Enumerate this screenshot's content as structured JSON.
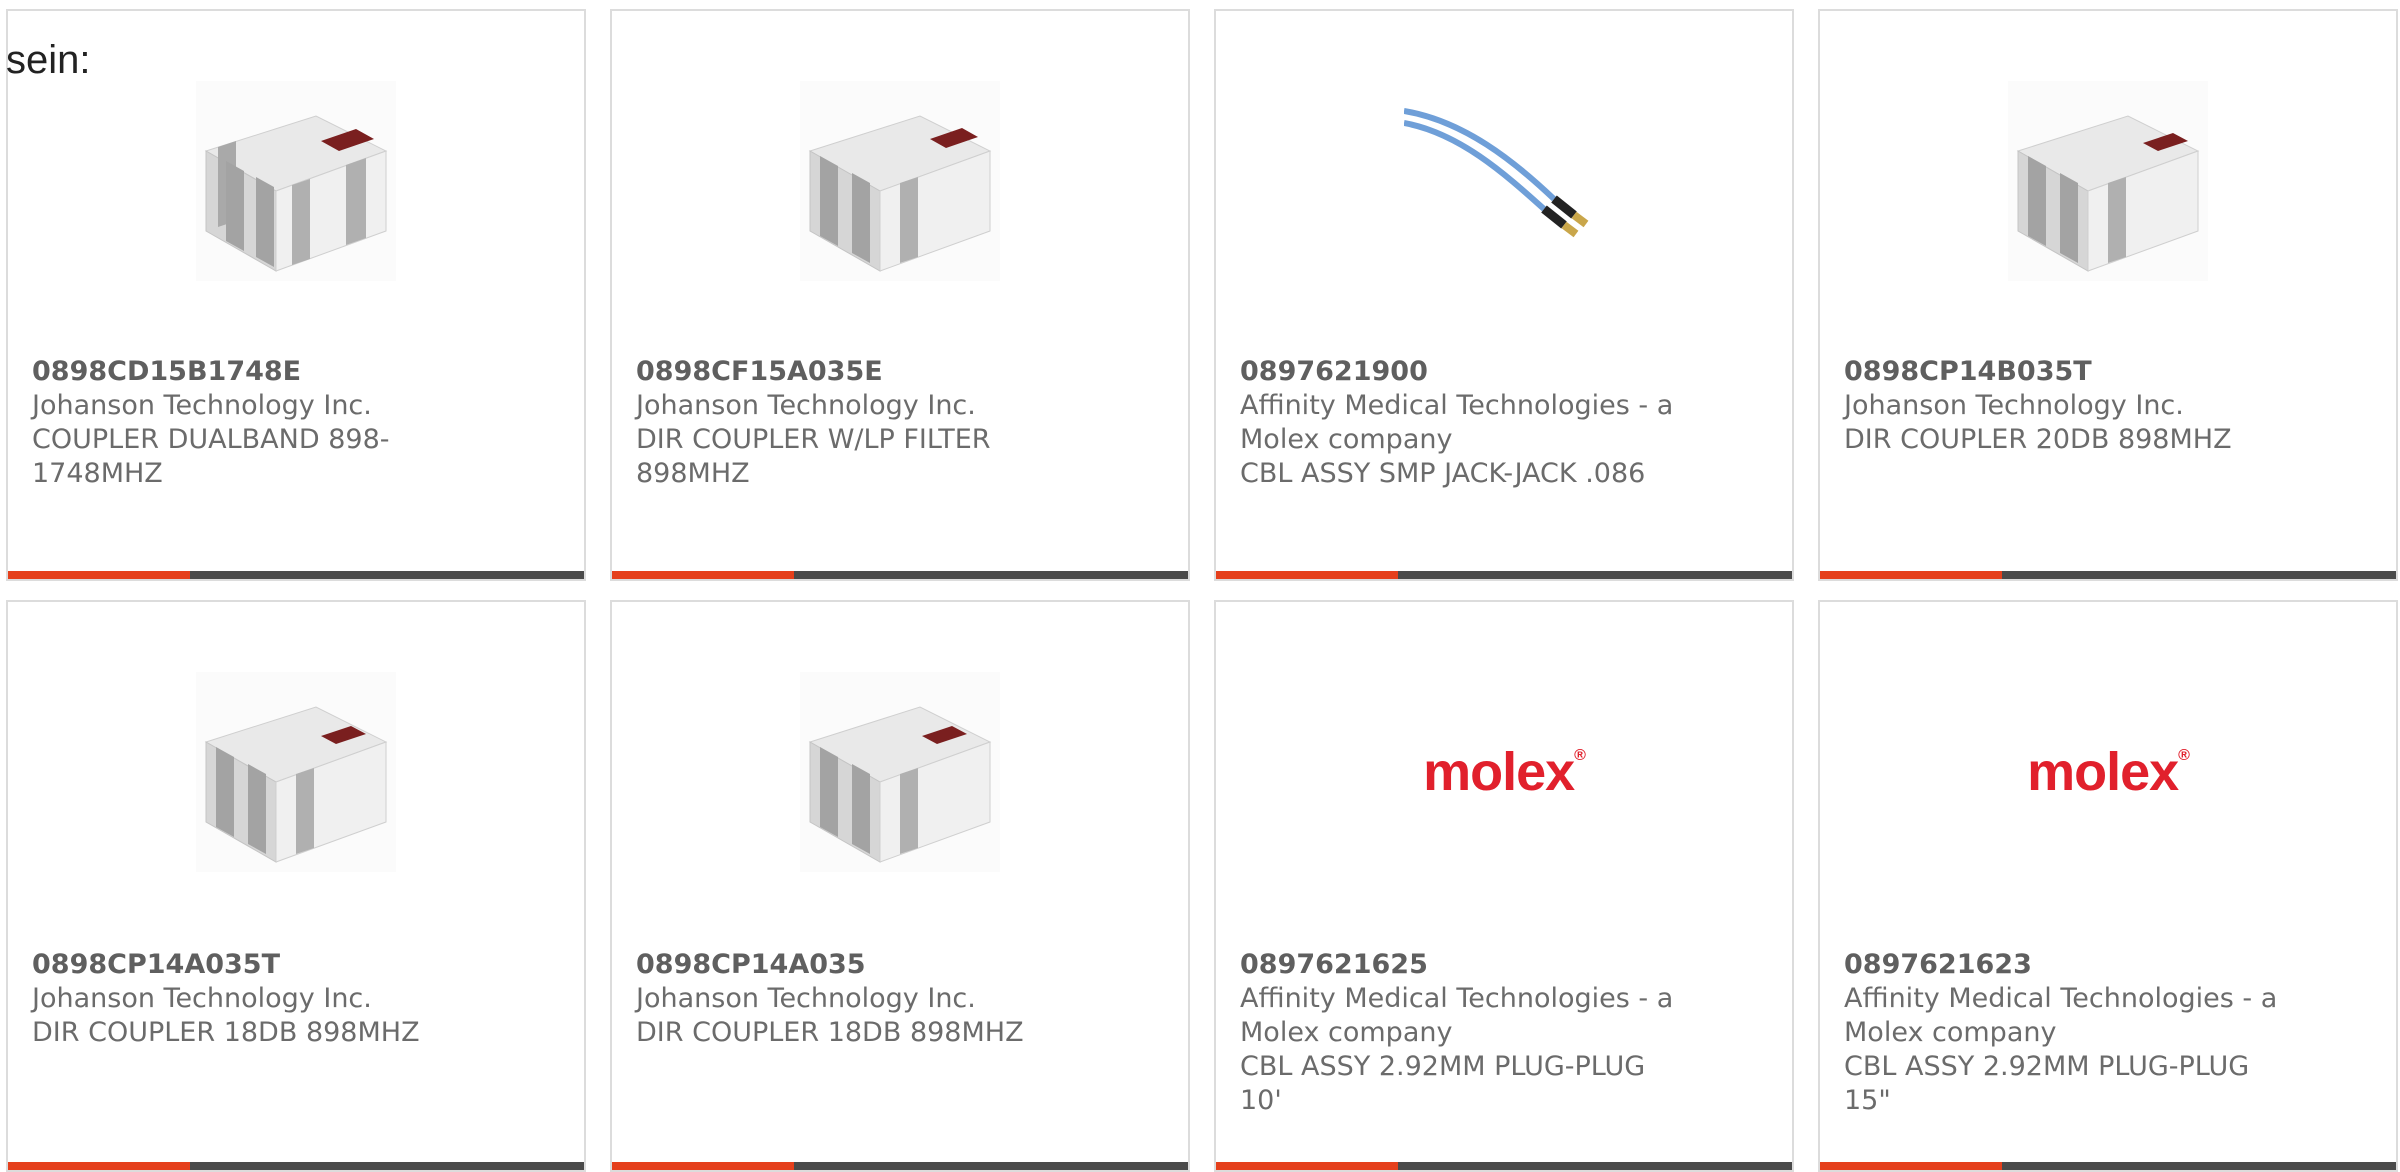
{
  "intro_text": "sein:",
  "colors": {
    "accent": "#e5401c",
    "bar": "#4a4a4a",
    "molex_red": "#e1202c",
    "cable_blue": "#6f9fd8"
  },
  "products": [
    {
      "part_number": "0898CD15B1748E",
      "manufacturer": "Johanson Technology Inc.",
      "description_lines": [
        "COUPLER DUALBAND 898-",
        "1748MHZ"
      ],
      "image": "chip-coupler-image"
    },
    {
      "part_number": "0898CF15A035E",
      "manufacturer": "Johanson Technology Inc.",
      "description_lines": [
        "DIR COUPLER W/LP FILTER",
        "898MHZ"
      ],
      "image": "chip-coupler-image"
    },
    {
      "part_number": "0897621900",
      "manufacturer_lines": [
        "Affinity Medical Technologies - a",
        "Molex company"
      ],
      "description_lines": [
        "CBL ASSY SMP JACK-JACK .086"
      ],
      "image": "cable-assembly-image"
    },
    {
      "part_number": "0898CP14B035T",
      "manufacturer": "Johanson Technology Inc.",
      "description_lines": [
        "DIR COUPLER 20DB 898MHZ"
      ],
      "image": "chip-coupler-image"
    },
    {
      "part_number": "0898CP14A035T",
      "manufacturer": "Johanson Technology Inc.",
      "description_lines": [
        "DIR COUPLER 18DB 898MHZ"
      ],
      "image": "chip-coupler-image"
    },
    {
      "part_number": "0898CP14A035",
      "manufacturer": "Johanson Technology Inc.",
      "description_lines": [
        "DIR COUPLER 18DB 898MHZ"
      ],
      "image": "chip-coupler-image"
    },
    {
      "part_number": "0897621625",
      "manufacturer_lines": [
        "Affinity Medical Technologies - a",
        "Molex company"
      ],
      "description_lines": [
        "CBL ASSY 2.92MM PLUG-PLUG",
        "10'"
      ],
      "image": "molex-logo",
      "logo_text": "molex"
    },
    {
      "part_number": "0897621623",
      "manufacturer_lines": [
        "Affinity Medical Technologies - a",
        "Molex company"
      ],
      "description_lines": [
        "CBL ASSY 2.92MM PLUG-PLUG",
        "15\""
      ],
      "image": "molex-logo",
      "logo_text": "molex"
    }
  ]
}
